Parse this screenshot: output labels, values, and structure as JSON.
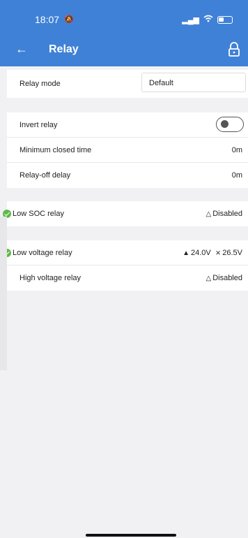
{
  "status_bar": {
    "time": "18:07",
    "bell_glyph": "🔕",
    "signal_glyph": ".ıl",
    "wifi_glyph": "ᯤ"
  },
  "header": {
    "title": "Relay",
    "back_glyph": "←"
  },
  "relay_mode": {
    "label": "Relay mode",
    "value": "Default"
  },
  "invert_group": {
    "invert_label": "Invert relay",
    "invert_on": false,
    "min_closed_label": "Minimum closed time",
    "min_closed_value": "0m",
    "off_delay_label": "Relay-off delay",
    "off_delay_value": "0m"
  },
  "low_soc": {
    "label": "Low SOC relay",
    "value": "Disabled",
    "enabled": true
  },
  "low_voltage": {
    "label": "Low voltage relay",
    "on_value": "24.0V",
    "off_value": "26.5V",
    "enabled": true
  },
  "high_voltage": {
    "label": "High voltage relay",
    "value": "Disabled"
  },
  "colors": {
    "header": "#3f81d6",
    "check": "#5fb94a",
    "background": "#f1f1f3"
  }
}
